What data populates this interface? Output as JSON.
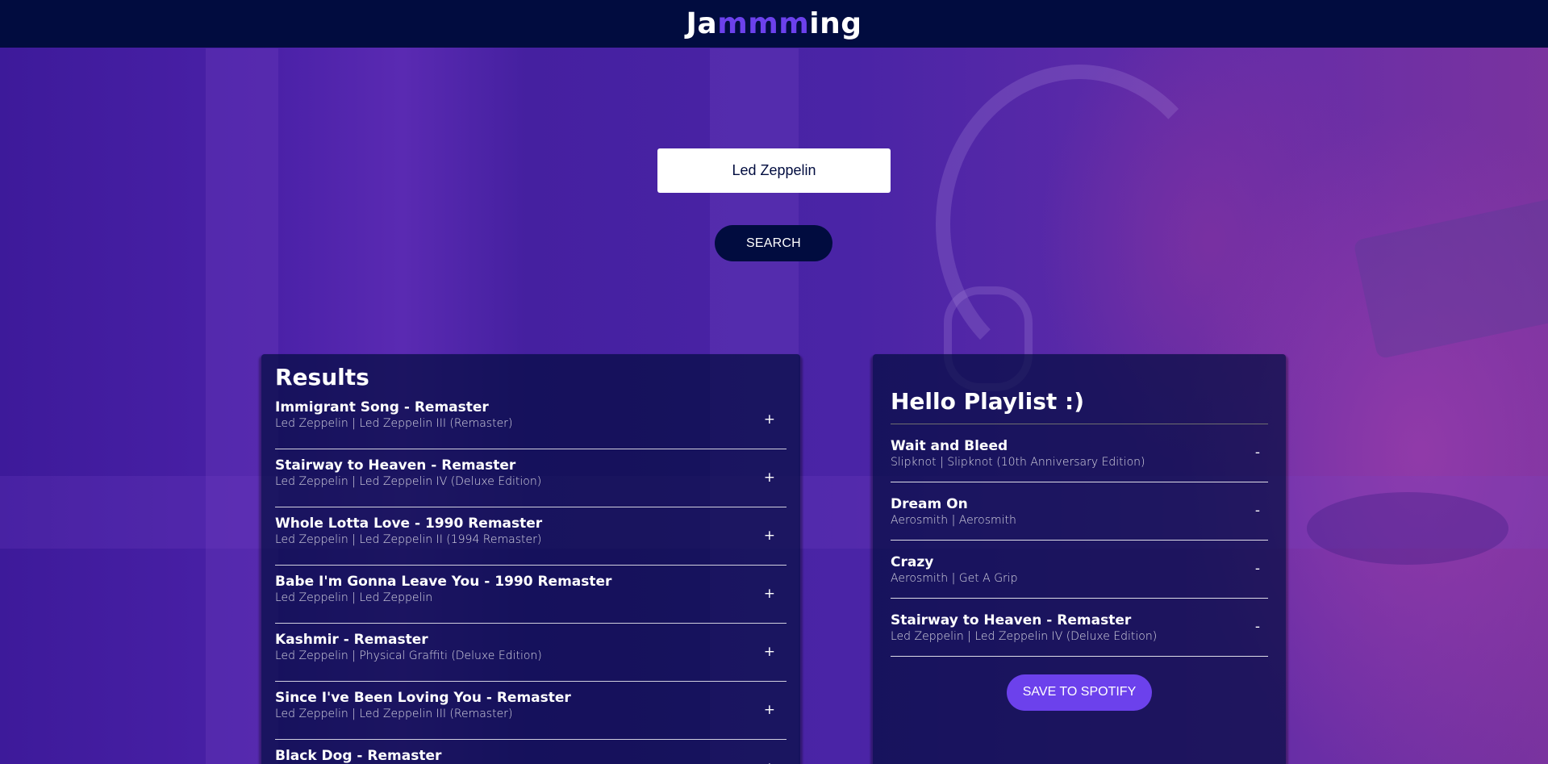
{
  "header": {
    "logo_prefix": "Ja",
    "logo_accent": "mmm",
    "logo_suffix": "ing"
  },
  "search": {
    "value": "Led Zeppelin",
    "button_label": "SEARCH"
  },
  "results": {
    "title": "Results",
    "add_symbol": "+",
    "tracks": [
      {
        "name": "Immigrant Song - Remaster",
        "info": "Led Zeppelin | Led Zeppelin III (Remaster)"
      },
      {
        "name": "Stairway to Heaven - Remaster",
        "info": "Led Zeppelin | Led Zeppelin IV (Deluxe Edition)"
      },
      {
        "name": "Whole Lotta Love - 1990 Remaster",
        "info": "Led Zeppelin | Led Zeppelin II (1994 Remaster)"
      },
      {
        "name": "Babe I'm Gonna Leave You - 1990 Remaster",
        "info": "Led Zeppelin | Led Zeppelin"
      },
      {
        "name": "Kashmir - Remaster",
        "info": "Led Zeppelin | Physical Graffiti (Deluxe Edition)"
      },
      {
        "name": "Since I've Been Loving You - Remaster",
        "info": "Led Zeppelin | Led Zeppelin III (Remaster)"
      },
      {
        "name": "Black Dog - Remaster",
        "info": ""
      }
    ]
  },
  "playlist": {
    "name": "Hello Playlist :)",
    "remove_symbol": "-",
    "save_label": "SAVE TO SPOTIFY",
    "tracks": [
      {
        "name": "Wait and Bleed",
        "info": "Slipknot | Slipknot (10th Anniversary Edition)"
      },
      {
        "name": "Dream On",
        "info": "Aerosmith | Aerosmith"
      },
      {
        "name": "Crazy",
        "info": "Aerosmith | Get A Grip"
      },
      {
        "name": "Stairway to Heaven - Remaster",
        "info": "Led Zeppelin | Led Zeppelin IV (Deluxe Edition)"
      }
    ]
  },
  "colors": {
    "header_bg": "#010c3f",
    "accent": "#6c41ec",
    "panel_bg": "rgba(1,12,63,0.7)"
  }
}
